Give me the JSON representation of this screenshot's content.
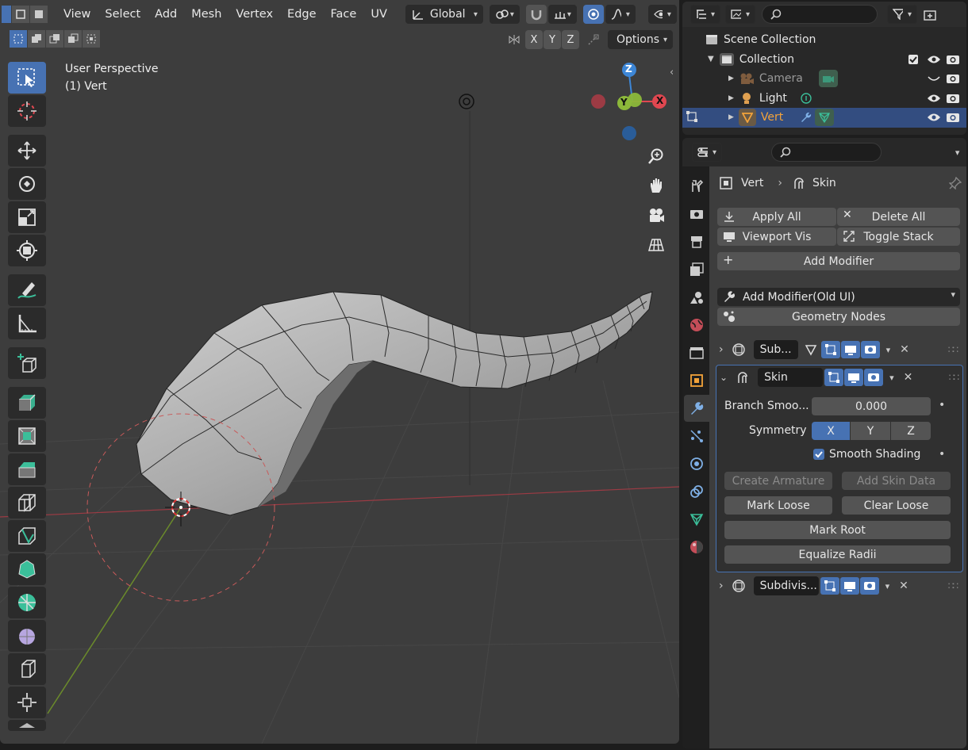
{
  "viewport": {
    "menus": [
      "View",
      "Select",
      "Add",
      "Mesh",
      "Vertex",
      "Edge",
      "Face",
      "UV"
    ],
    "transform_orientation": "Global",
    "axes": [
      "X",
      "Y",
      "Z"
    ],
    "options_label": "Options",
    "info_line1": "User Perspective",
    "info_line2": "(1) Vert",
    "gizmo": {
      "z": "Z",
      "y": "Y",
      "x": "X"
    }
  },
  "outliner": {
    "rows": [
      {
        "label": "Scene Collection"
      },
      {
        "label": "Collection"
      },
      {
        "label": "Camera"
      },
      {
        "label": "Light"
      },
      {
        "label": "Vert"
      }
    ]
  },
  "properties": {
    "breadcrumb_object": "Vert",
    "breadcrumb_modifier": "Skin",
    "apply_all": "Apply All",
    "delete_all": "Delete All",
    "viewport_vis": "Viewport Vis",
    "toggle_stack": "Toggle Stack",
    "add_modifier": "Add Modifier",
    "add_modifier_old": "Add Modifier(Old UI)",
    "geometry_nodes": "Geometry Nodes",
    "modifiers": [
      {
        "name": "Sub..."
      },
      {
        "name": "Skin"
      },
      {
        "name": "Subdivis..."
      }
    ],
    "skin": {
      "branch_label": "Branch Smoo...",
      "branch_value": "0.000",
      "symmetry_label": "Symmetry",
      "sym_x": "X",
      "sym_y": "Y",
      "sym_z": "Z",
      "smooth_shading": "Smooth Shading",
      "create_armature": "Create Armature",
      "add_skin_data": "Add Skin Data",
      "mark_loose": "Mark Loose",
      "clear_loose": "Clear Loose",
      "mark_root": "Mark Root",
      "equalize_radii": "Equalize Radii"
    }
  },
  "colors": {
    "accent": "#4772b3",
    "selected_row": "#334d80",
    "active_object": "#f3a33a",
    "axis_x": "#e04750",
    "axis_y": "#8cb83a",
    "axis_z": "#3d86d6"
  }
}
